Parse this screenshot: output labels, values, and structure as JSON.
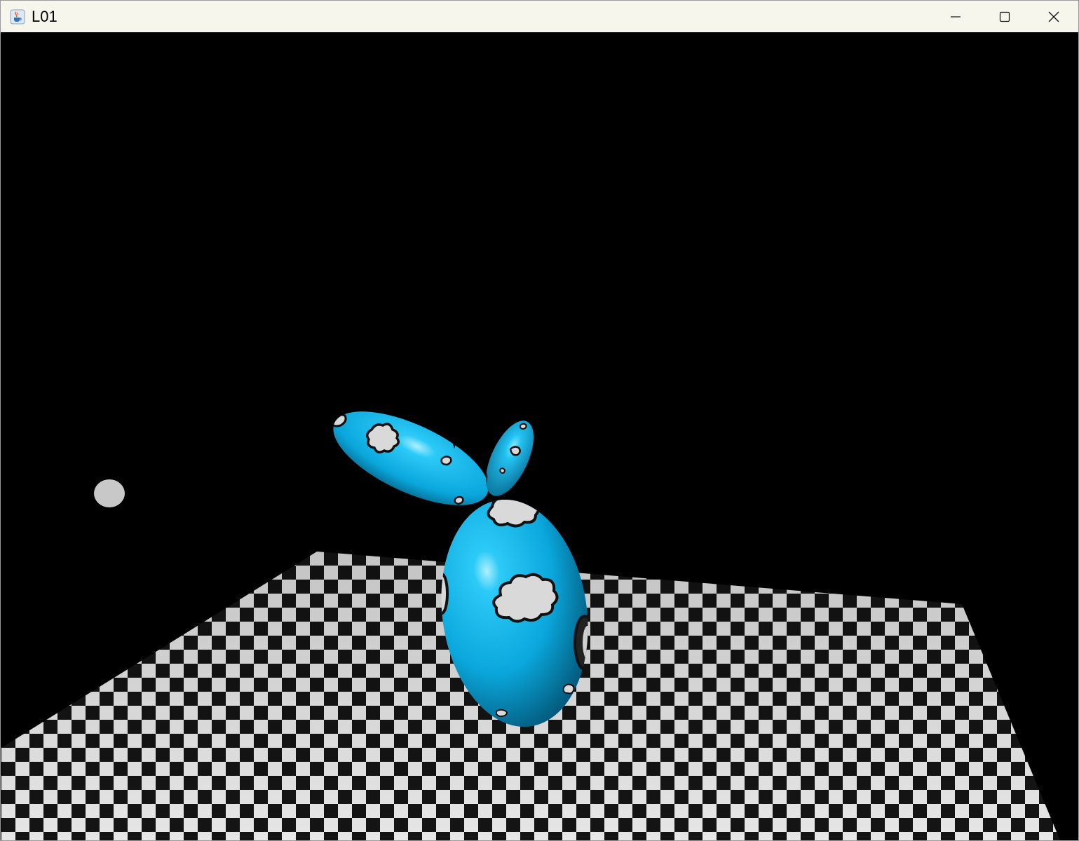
{
  "window": {
    "title": "L01",
    "app_icon": "java-coffee-cup-icon",
    "controls": {
      "minimize_icon": "minimize-icon",
      "maximize_icon": "maximize-icon",
      "close_icon": "close-icon"
    }
  },
  "scene": {
    "background_color": "#000000",
    "balloon_color": "#0db4e8",
    "highlight_color": "#aef0ff",
    "cloud_color": "#d9d9d9",
    "cloud_outline_color": "#111111",
    "light_marker_color": "#c8c8c8",
    "floor_pattern": "checkerboard",
    "floor_light_color": "#e6e6e6",
    "floor_dark_color": "#141414"
  }
}
